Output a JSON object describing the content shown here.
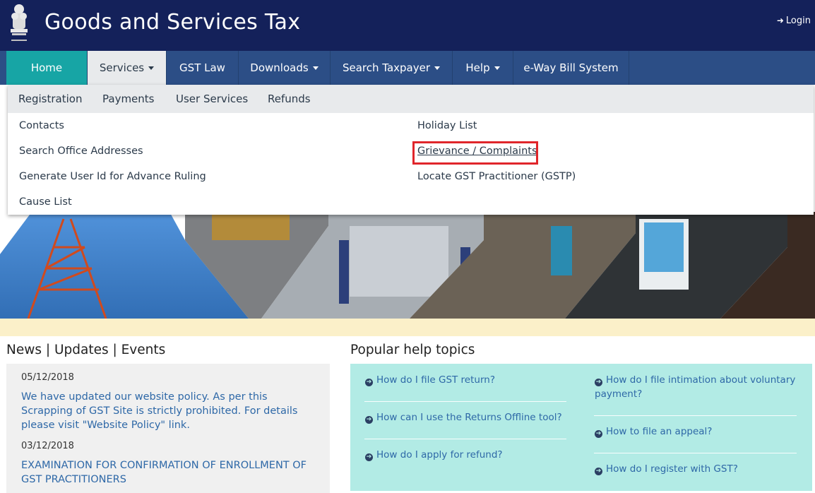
{
  "header": {
    "title": "Goods and Services Tax",
    "login_label": "Login"
  },
  "nav": {
    "items": [
      {
        "label": "Home"
      },
      {
        "label": "Services"
      },
      {
        "label": "GST Law"
      },
      {
        "label": "Downloads"
      },
      {
        "label": "Search Taxpayer"
      },
      {
        "label": "Help"
      },
      {
        "label": "e-Way Bill System"
      }
    ]
  },
  "dropdown": {
    "tabs": [
      "Registration",
      "Payments",
      "User Services",
      "Refunds"
    ],
    "left_links": [
      "Contacts",
      "Search Office Addresses",
      "Generate User Id for Advance Ruling",
      "Cause List"
    ],
    "right_links": [
      "Holiday List",
      "Grievance / Complaints",
      "Locate GST Practitioner (GSTP)"
    ]
  },
  "news": {
    "title": "News | Updates | Events",
    "items": [
      {
        "date": "05/12/2018",
        "text": "We have updated our website policy. As per this Scrapping of GST Site is strictly prohibited. For details please visit \"Website Policy\" link."
      },
      {
        "date": "03/12/2018",
        "text": "EXAMINATION FOR CONFIRMATION OF ENROLLMENT OF GST PRACTITIONERS"
      }
    ]
  },
  "help": {
    "title": "Popular help topics",
    "left": [
      "How do I file GST return?",
      "How can I use the Returns Offline tool?",
      "How do I apply for refund?"
    ],
    "right": [
      "How do I file intimation about voluntary payment?",
      "How to file an appeal?",
      "How do I register with GST?"
    ]
  },
  "colors": {
    "header_bg": "#14215a",
    "nav_bg": "#2c4e86",
    "home_tab": "#17a5a5",
    "highlight_box": "#e0262b",
    "help_box": "#b2ebe5",
    "link": "#2e68a7"
  }
}
